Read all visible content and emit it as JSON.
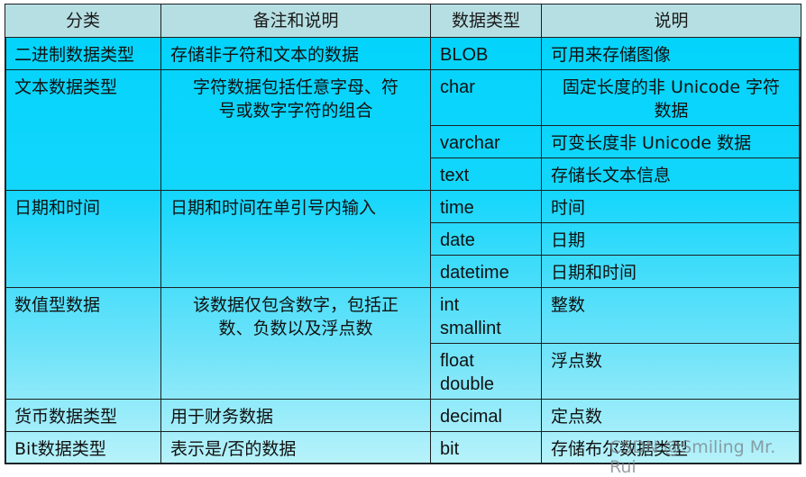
{
  "header": {
    "col1": "分类",
    "col2": "备注和说明",
    "col3": "数据类型",
    "col4": "说明"
  },
  "groups": [
    {
      "category": "二进制数据类型",
      "note": "存储非子符和文本的数据",
      "types": [
        {
          "type": "BLOB",
          "desc": "可用来存储图像"
        }
      ]
    },
    {
      "category": "文本数据类型",
      "note": "字符数据包括任意字母、符号或数字字符的组合",
      "types": [
        {
          "type": "char",
          "desc": "固定长度的非 Unicode 字符数据"
        },
        {
          "type": "varchar",
          "desc": "可变长度非 Unicode 数据"
        },
        {
          "type": "text",
          "desc": "存储长文本信息"
        }
      ]
    },
    {
      "category": "日期和时间",
      "note": "日期和时间在单引号内输入",
      "types": [
        {
          "type": "time",
          "desc": "时间"
        },
        {
          "type": "date",
          "desc": "日期"
        },
        {
          "type": "datetime",
          "desc": "日期和时间"
        }
      ]
    },
    {
      "category": "数值型数据",
      "note": "该数据仅包含数字，包括正数、负数以及浮点数",
      "types": [
        {
          "type": "int\nsmallint",
          "type_line1": "int",
          "type_line2": "smallint",
          "desc": "整数"
        },
        {
          "type": "float\ndouble",
          "type_line1": "float",
          "type_line2": "double",
          "desc": "浮点数"
        }
      ]
    },
    {
      "category": "货币数据类型",
      "note": "用于财务数据",
      "types": [
        {
          "type": "decimal",
          "desc": "定点数"
        }
      ]
    },
    {
      "category": "Bit数据类型",
      "note": "表示是/否的数据",
      "types": [
        {
          "type": "bit",
          "desc": "存储布尔数据类型"
        }
      ]
    }
  ],
  "notes_split": {
    "text_note_line1": "字符数据包括任意字母、符",
    "text_note_line2": "号或数字字符的组合",
    "numeric_note_line1": "该数据仅包含数字，包括正",
    "numeric_note_line2": "数、负数以及浮点数",
    "char_desc_line1": "固定长度的非 Unicode 字符",
    "char_desc_line2": "数据"
  },
  "watermark": "CSDN @Smiling Mr. Rui",
  "colors": {
    "header_bg": "#b6dfe3",
    "body_top": "#00d3fb",
    "body_bottom": "#b7f2fa",
    "border": "#1a1f22"
  }
}
